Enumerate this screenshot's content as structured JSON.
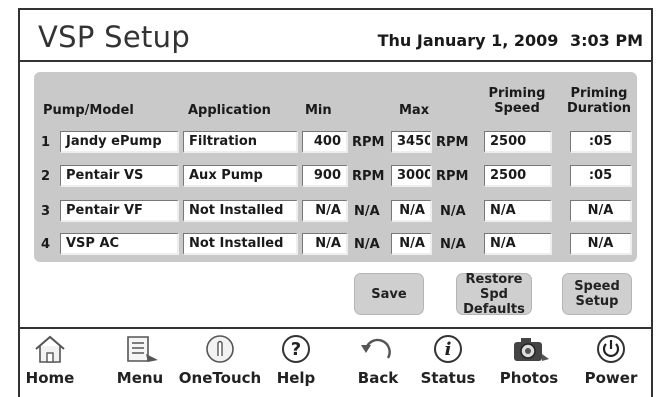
{
  "header": {
    "title": "VSP Setup",
    "date": "Thu January 1, 2009",
    "time": "3:03 PM"
  },
  "columns": {
    "pump_model": "Pump/Model",
    "application": "Application",
    "min": "Min",
    "max": "Max",
    "priming_speed": "Priming Speed",
    "priming_duration": "Priming Duration"
  },
  "rows": [
    {
      "num": "1",
      "pump": "Jandy ePump",
      "application": "Filtration",
      "min": "400",
      "min_unit": "RPM",
      "max": "3450",
      "max_unit": "RPM",
      "priming_speed": "2500",
      "priming_duration": ":05"
    },
    {
      "num": "2",
      "pump": "Pentair VS",
      "application": "Aux Pump",
      "min": "900",
      "min_unit": "RPM",
      "max": "3000",
      "max_unit": "RPM",
      "priming_speed": "2500",
      "priming_duration": ":05"
    },
    {
      "num": "3",
      "pump": "Pentair VF",
      "application": "Not Installed",
      "min": "N/A",
      "min_unit": "N/A",
      "max": "N/A",
      "max_unit": "N/A",
      "priming_speed": "N/A",
      "priming_duration": "N/A"
    },
    {
      "num": "4",
      "pump": "VSP AC",
      "application": "Not Installed",
      "min": "N/A",
      "min_unit": "N/A",
      "max": "N/A",
      "max_unit": "N/A",
      "priming_speed": "N/A",
      "priming_duration": "N/A"
    }
  ],
  "buttons": {
    "save": "Save",
    "restore": "Restore Spd Defaults",
    "speed_setup": "Speed Setup"
  },
  "nav": [
    {
      "label": "Home",
      "icon": "home-icon"
    },
    {
      "label": "Menu",
      "icon": "menu-icon"
    },
    {
      "label": "OneTouch",
      "icon": "onetouch-icon"
    },
    {
      "label": "Help",
      "icon": "help-icon"
    },
    {
      "label": "Back",
      "icon": "back-icon"
    },
    {
      "label": "Status",
      "icon": "status-icon"
    },
    {
      "label": "Photos",
      "icon": "photos-icon"
    },
    {
      "label": "Power",
      "icon": "power-icon"
    }
  ]
}
